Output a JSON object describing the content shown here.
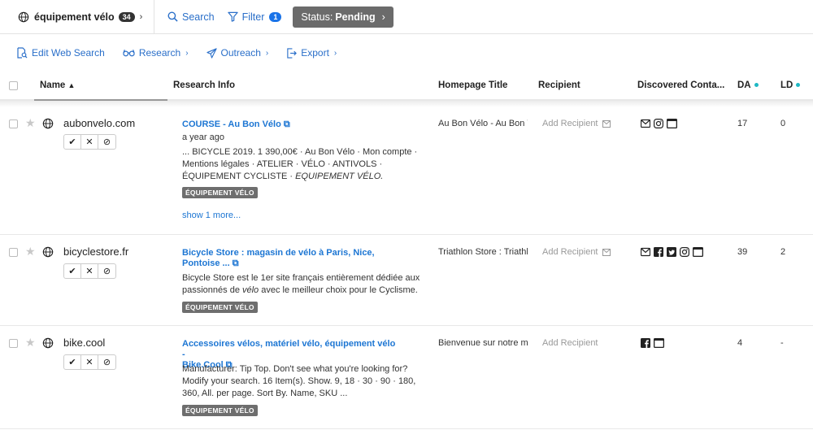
{
  "topbar": {
    "campaign_name": "équipement vélo",
    "campaign_count": "34",
    "search_label": "Search",
    "filter_label": "Filter",
    "filter_count": "1",
    "status_prefix": "Status:",
    "status_value": "Pending"
  },
  "toolbar": {
    "edit_web_search": "Edit Web Search",
    "research": "Research",
    "outreach": "Outreach",
    "export": "Export"
  },
  "columns": {
    "name": "Name",
    "research_info": "Research Info",
    "homepage_title": "Homepage Title",
    "recipient": "Recipient",
    "discovered_contacts": "Discovered Conta...",
    "da": "DA",
    "ld": "LD"
  },
  "rows": [
    {
      "domain": "aubonvelo.com",
      "title": "COURSE - Au Bon Vélo",
      "meta": "a year ago",
      "snippet_line1": "... BICYCLE 2019. 1 390,00€ · Au Bon Vélo · Mon compte ·",
      "snippet_line2": "Mentions légales · ATELIER · VÉLO · ANTIVOLS ·",
      "snippet_line3_prefix": "ÉQUIPEMENT CYCLISTE · ",
      "snippet_line3_em": "EQUIPEMENT VÉLO.",
      "tag": "ÉQUIPEMENT VÉLO",
      "show_more": "show 1 more...",
      "homepage_title": "Au Bon Vélo - Au Bon Vélo",
      "recipient": "Add Recipient",
      "contacts": [
        "mail-icon",
        "instagram-icon",
        "window-icon"
      ],
      "da": "17",
      "ld": "0"
    },
    {
      "domain": "bicyclestore.fr",
      "title_line1": "Bicycle Store : magasin de vélo à Paris, Nice,",
      "title_line2": "Pontoise ...",
      "snippet_line1": "Bicycle Store est le 1er site français entièrement dédiée aux",
      "snippet_line2_prefix": "passionnés de ",
      "snippet_line2_em": "vélo",
      "snippet_line2_suffix": " avec le meilleur choix pour le Cyclisme.",
      "tag": "ÉQUIPEMENT VÉLO",
      "homepage_title": "Triathlon Store : Triathlon",
      "recipient": "Add Recipient",
      "contacts": [
        "mail-icon",
        "facebook-icon",
        "twitter-icon",
        "instagram-icon",
        "window-icon"
      ],
      "da": "39",
      "ld": "2"
    },
    {
      "domain": "bike.cool",
      "title_line1": "Accessoires vélos, matériel vélo, équipement vélo -",
      "title_line2": "Bike.Cool",
      "snippet_line1": "Manufacturer: Tip Top. Don't see what you're looking for?",
      "snippet_line2": "Modify your search. 16 Item(s). Show. 9, 18 · 30 · 90 · 180,",
      "snippet_line3": "360, All. per page. Sort By. Name, SKU ...",
      "tag": "ÉQUIPEMENT VÉLO",
      "homepage_title": "Bienvenue sur notre magasin",
      "recipient": "Add Recipient",
      "contacts": [
        "facebook-icon",
        "window-icon"
      ],
      "da": "4",
      "ld": "-"
    }
  ],
  "colors": {
    "link": "#1d76d3",
    "accent": "#2a6fc9",
    "tag_bg": "#6e6e6e",
    "status_bg": "#6b6b6b",
    "dot": "#1fb8c4"
  }
}
